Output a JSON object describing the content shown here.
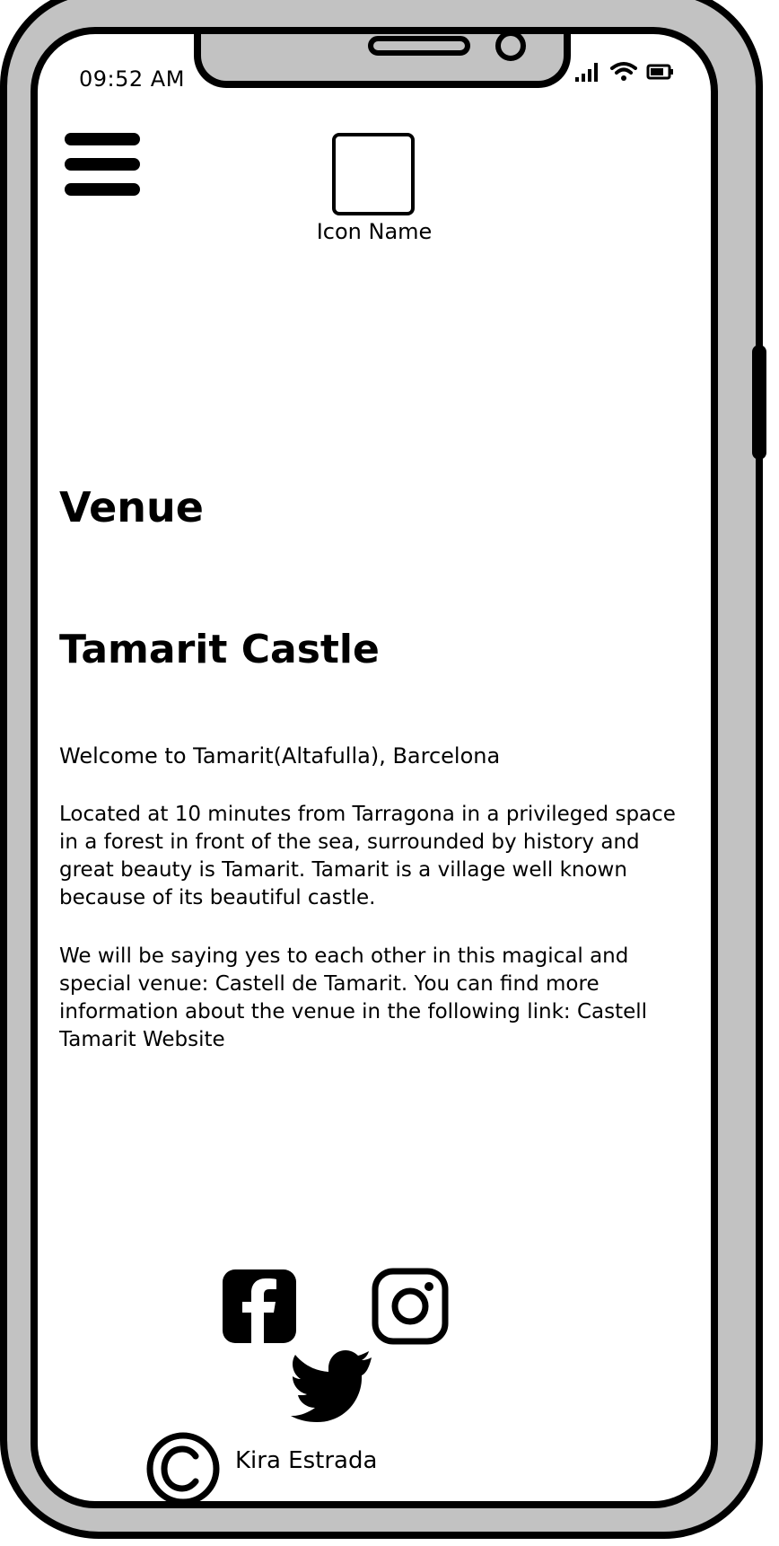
{
  "status_bar": {
    "time": "09:52 AM",
    "icons": [
      "signal-icon",
      "wifi-icon",
      "battery-icon"
    ]
  },
  "header": {
    "menu_icon": "hamburger-menu-icon",
    "logo_label": "Icon Name"
  },
  "main": {
    "section_title": "Venue",
    "venue_name": "Tamarit Castle",
    "welcome": "Welcome to Tamarit(Altafulla), Barcelona",
    "paragraph_1": "Located at 10 minutes from Tarragona in a privileged space in a forest in front of the sea, surrounded by history and great beauty is Tamarit. Tamarit is a village well known because of its beautiful castle.",
    "paragraph_2": "We will be saying yes to each other in this magical and special venue: Castell de Tamarit. You can find more information about the venue in the following link: Castell Tamarit Website"
  },
  "footer": {
    "social_icons": [
      "facebook-icon",
      "instagram-icon",
      "twitter-icon"
    ],
    "copyright_icon": "copyright-icon",
    "copyright_name": "Kira Estrada"
  },
  "colors": {
    "frame": "#c2c2c2",
    "ink": "#000000",
    "screen": "#ffffff"
  }
}
